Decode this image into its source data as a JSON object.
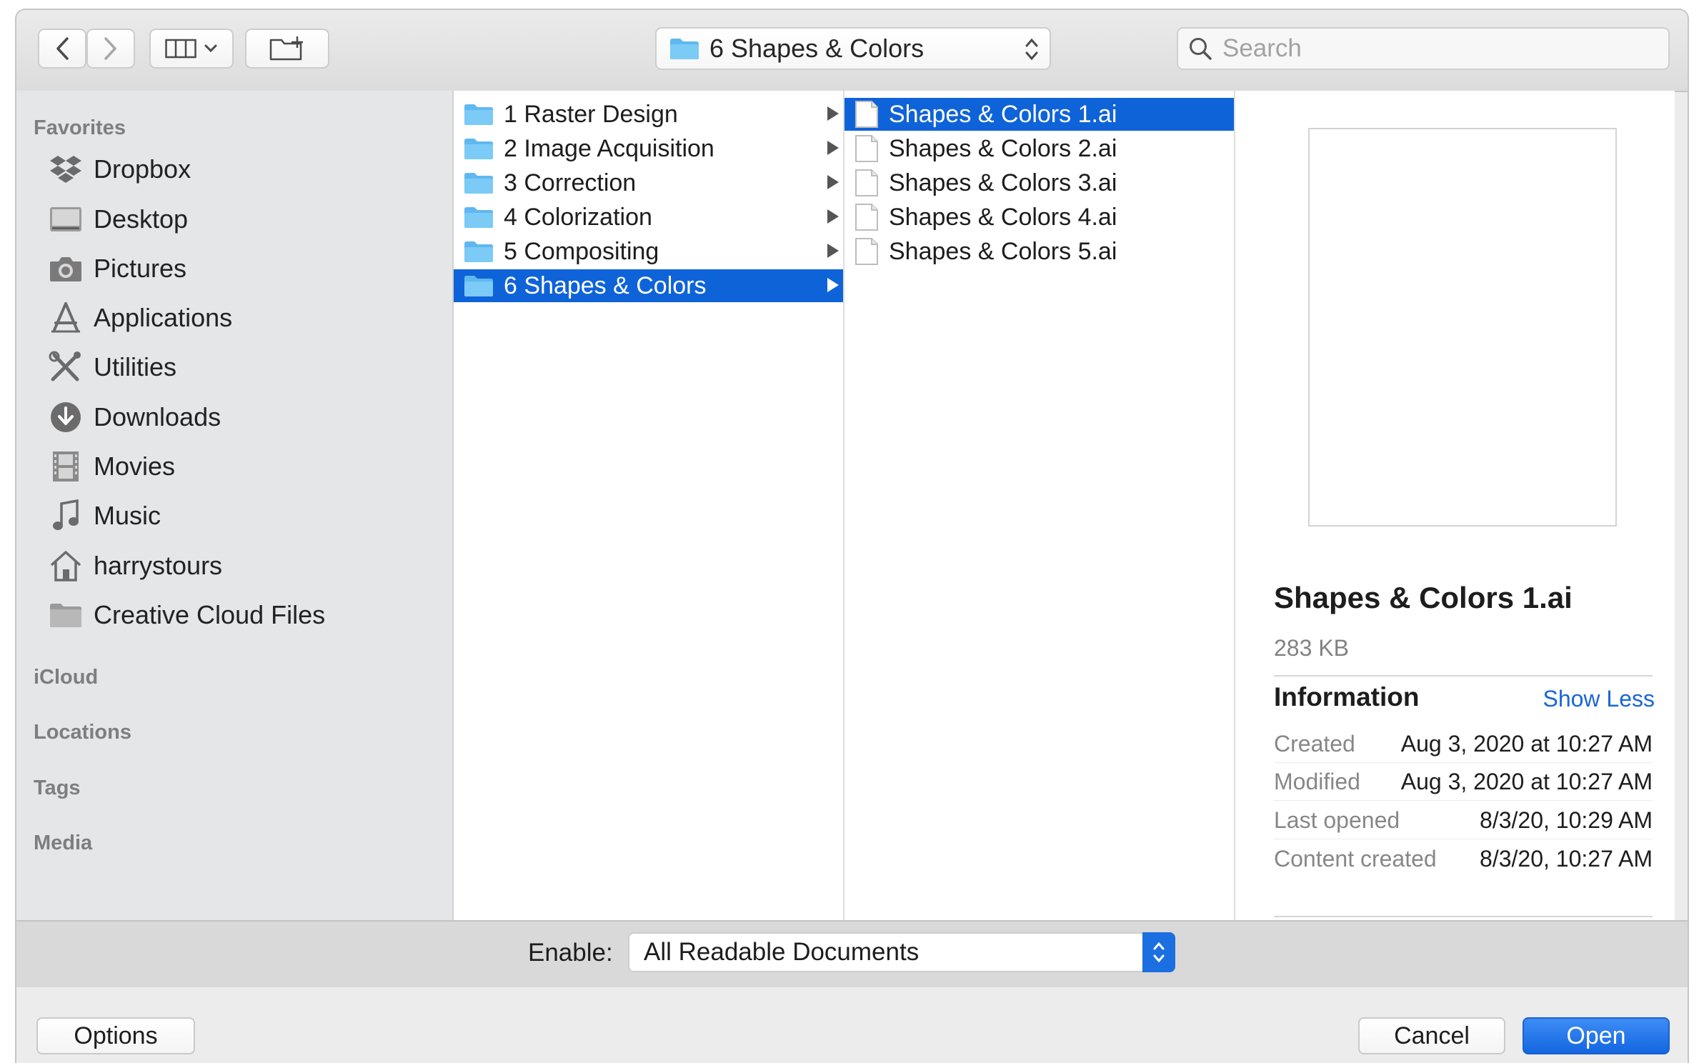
{
  "toolbar": {
    "path_label": "6 Shapes & Colors",
    "search_placeholder": "Search"
  },
  "sidebar": {
    "favorites_label": "Favorites",
    "items": [
      {
        "label": "Dropbox",
        "icon": "dropbox-icon"
      },
      {
        "label": "Desktop",
        "icon": "desktop-icon"
      },
      {
        "label": "Pictures",
        "icon": "camera-icon"
      },
      {
        "label": "Applications",
        "icon": "applications-icon"
      },
      {
        "label": "Utilities",
        "icon": "tools-icon"
      },
      {
        "label": "Downloads",
        "icon": "download-icon"
      },
      {
        "label": "Movies",
        "icon": "film-icon"
      },
      {
        "label": "Music",
        "icon": "music-note-icon"
      },
      {
        "label": "harrystours",
        "icon": "home-icon"
      },
      {
        "label": "Creative Cloud Files",
        "icon": "folder-icon"
      }
    ],
    "icloud_label": "iCloud",
    "locations_label": "Locations",
    "tags_label": "Tags",
    "media_label": "Media"
  },
  "folders": [
    "1 Raster Design",
    "2 Image Acquisition",
    "3 Correction",
    "4 Colorization",
    "5 Compositing",
    "6 Shapes & Colors"
  ],
  "selected_folder_index": 5,
  "files": [
    "Shapes & Colors 1.ai",
    "Shapes & Colors 2.ai",
    "Shapes & Colors 3.ai",
    "Shapes & Colors 4.ai",
    "Shapes & Colors 5.ai"
  ],
  "selected_file_index": 0,
  "preview": {
    "name": "Shapes & Colors 1.ai",
    "size": "283 KB",
    "info_label": "Information",
    "toggle_label": "Show Less",
    "rows": [
      {
        "key": "Created",
        "value": "Aug 3, 2020 at 10:27 AM"
      },
      {
        "key": "Modified",
        "value": "Aug 3, 2020 at 10:27 AM"
      },
      {
        "key": "Last opened",
        "value": "8/3/20, 10:29 AM"
      },
      {
        "key": "Content created",
        "value": "8/3/20, 10:27 AM"
      }
    ]
  },
  "enable": {
    "label": "Enable:",
    "value": "All Readable Documents"
  },
  "buttons": {
    "options": "Options",
    "cancel": "Cancel",
    "open": "Open"
  },
  "colors": {
    "selection": "#0f63d8",
    "folder": "#5fb8ef",
    "link": "#1a66d6",
    "primary_button": "#1466e0"
  }
}
